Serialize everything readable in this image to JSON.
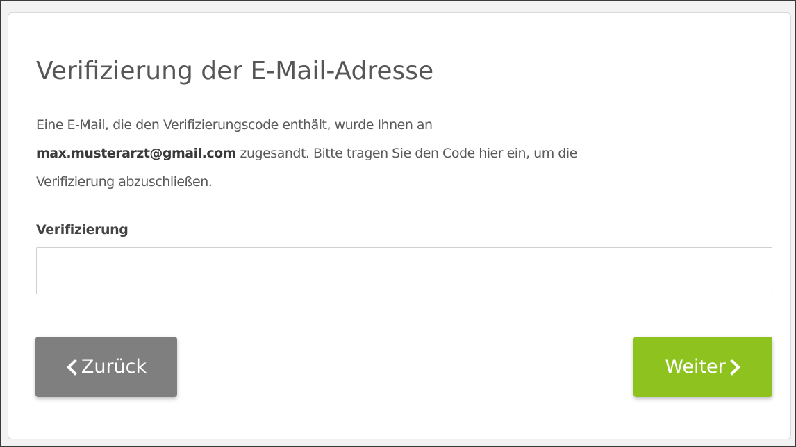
{
  "verification": {
    "title": "Verifizierung der E-Mail-Adresse",
    "intro": {
      "line1": "Eine E-Mail, die den Verifizierungscode enthält, wurde Ihnen an",
      "email": "max.musterarzt@gmail.com",
      "line2": "zugesandt. Bitte tragen Sie den Code hier ein, um die",
      "line3": "Verifizierung abzuschließen."
    },
    "field": {
      "label": "Verifizierung",
      "value": "",
      "placeholder": ""
    },
    "buttons": {
      "back_label": "Zurück",
      "next_label": "Weiter"
    }
  },
  "icons": {
    "back": "chevron-left-icon",
    "next": "chevron-right-icon"
  },
  "colors": {
    "back_button": "#7f7f7f",
    "next_button": "#8dc21f",
    "title_text": "#565656"
  }
}
